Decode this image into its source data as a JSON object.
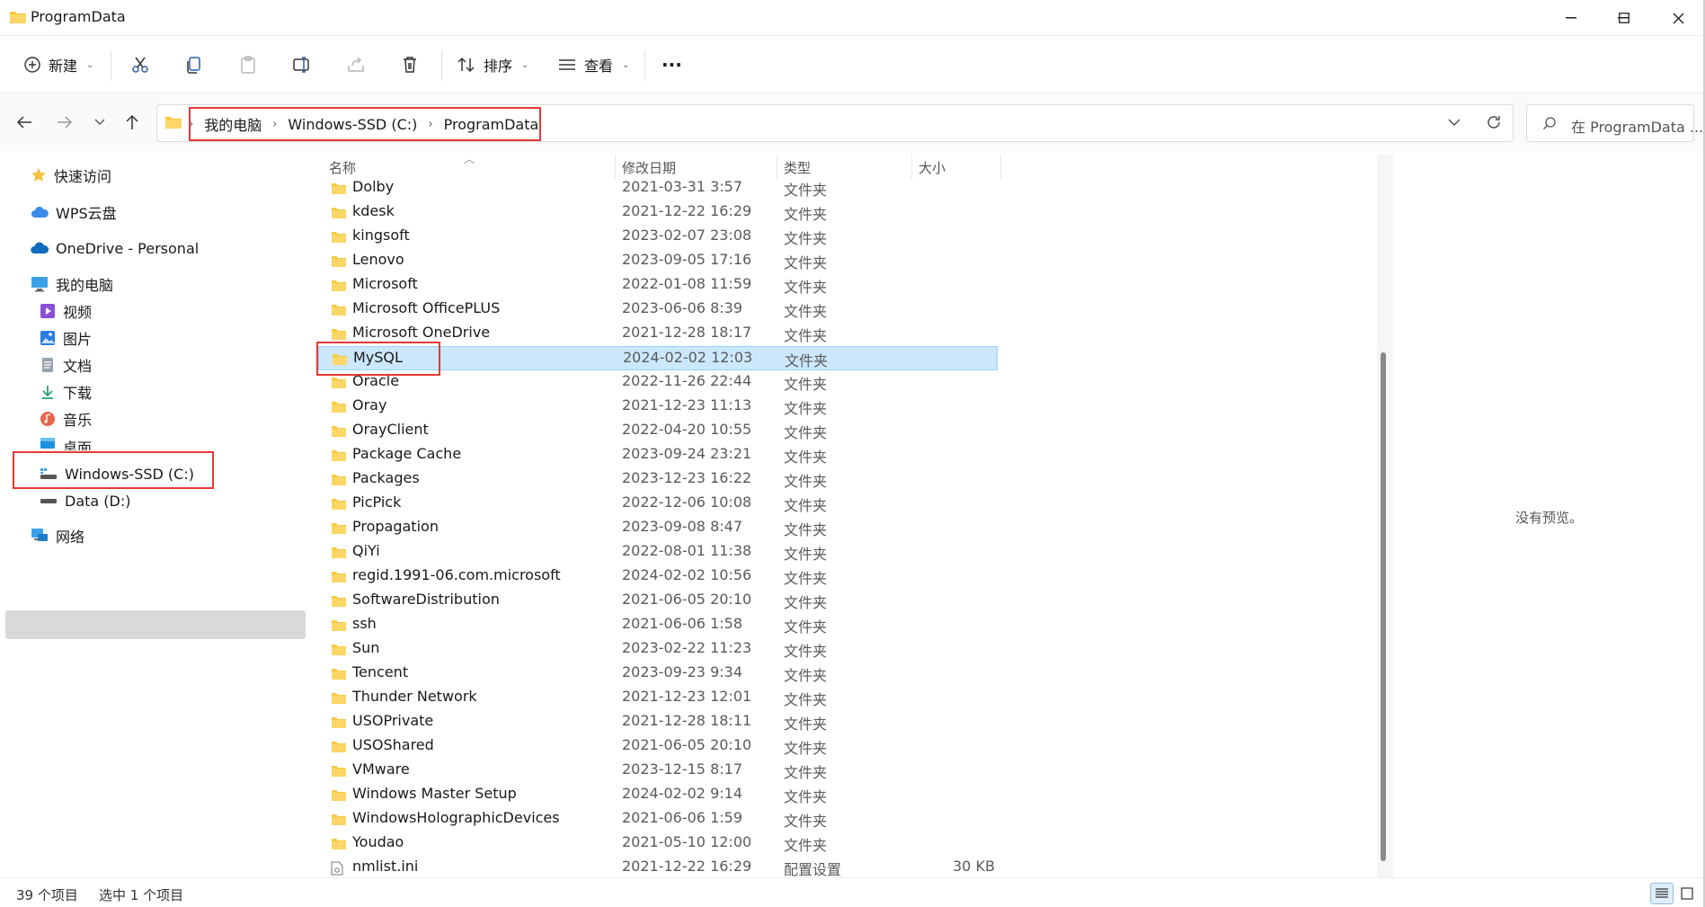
{
  "window": {
    "title": "ProgramData",
    "minimize_icon": "minimize-icon",
    "maximize_icon": "maximize-icon",
    "close_icon": "close-icon"
  },
  "toolbar": {
    "new_label": "新建",
    "sort_label": "排序",
    "view_label": "查看",
    "more_label": "···"
  },
  "address": {
    "crumbs": [
      "我的电脑",
      "Windows-SSD (C:)",
      "ProgramData"
    ],
    "search_placeholder": "在 ProgramData ..."
  },
  "sidebar": {
    "items": [
      {
        "label": "快速访问",
        "icon": "star-icon"
      },
      {
        "label": "WPS云盘",
        "icon": "cloud-icon"
      },
      {
        "label": "OneDrive - Personal",
        "icon": "onedrive-icon"
      },
      {
        "label": "我的电脑",
        "icon": "computer-icon"
      },
      {
        "label": "视频",
        "icon": "video-icon"
      },
      {
        "label": "图片",
        "icon": "picture-icon"
      },
      {
        "label": "文档",
        "icon": "document-icon"
      },
      {
        "label": "下载",
        "icon": "download-icon"
      },
      {
        "label": "音乐",
        "icon": "music-icon"
      },
      {
        "label": "桌面",
        "icon": "desktop-icon"
      },
      {
        "label": "Windows-SSD (C:)",
        "icon": "drive-icon"
      },
      {
        "label": "Data (D:)",
        "icon": "drive-icon"
      },
      {
        "label": "网络",
        "icon": "network-icon"
      }
    ]
  },
  "columns": {
    "name": "名称",
    "date": "修改日期",
    "type": "类型",
    "size": "大小"
  },
  "files": [
    {
      "name": "Dolby",
      "date": "2021-03-31 3:57",
      "type": "文件夹",
      "size": ""
    },
    {
      "name": "kdesk",
      "date": "2021-12-22 16:29",
      "type": "文件夹",
      "size": ""
    },
    {
      "name": "kingsoft",
      "date": "2023-02-07 23:08",
      "type": "文件夹",
      "size": ""
    },
    {
      "name": "Lenovo",
      "date": "2023-09-05 17:16",
      "type": "文件夹",
      "size": ""
    },
    {
      "name": "Microsoft",
      "date": "2022-01-08 11:59",
      "type": "文件夹",
      "size": ""
    },
    {
      "name": "Microsoft OfficePLUS",
      "date": "2023-06-06 8:39",
      "type": "文件夹",
      "size": ""
    },
    {
      "name": "Microsoft OneDrive",
      "date": "2021-12-28 18:17",
      "type": "文件夹",
      "size": ""
    },
    {
      "name": "MySQL",
      "date": "2024-02-02 12:03",
      "type": "文件夹",
      "size": ""
    },
    {
      "name": "Oracle",
      "date": "2022-11-26 22:44",
      "type": "文件夹",
      "size": ""
    },
    {
      "name": "Oray",
      "date": "2021-12-23 11:13",
      "type": "文件夹",
      "size": ""
    },
    {
      "name": "OrayClient",
      "date": "2022-04-20 10:55",
      "type": "文件夹",
      "size": ""
    },
    {
      "name": "Package Cache",
      "date": "2023-09-24 23:21",
      "type": "文件夹",
      "size": ""
    },
    {
      "name": "Packages",
      "date": "2023-12-23 16:22",
      "type": "文件夹",
      "size": ""
    },
    {
      "name": "PicPick",
      "date": "2022-12-06 10:08",
      "type": "文件夹",
      "size": ""
    },
    {
      "name": "Propagation",
      "date": "2023-09-08 8:47",
      "type": "文件夹",
      "size": ""
    },
    {
      "name": "QiYi",
      "date": "2022-08-01 11:38",
      "type": "文件夹",
      "size": ""
    },
    {
      "name": "regid.1991-06.com.microsoft",
      "date": "2024-02-02 10:56",
      "type": "文件夹",
      "size": ""
    },
    {
      "name": "SoftwareDistribution",
      "date": "2021-06-05 20:10",
      "type": "文件夹",
      "size": ""
    },
    {
      "name": "ssh",
      "date": "2021-06-06 1:58",
      "type": "文件夹",
      "size": ""
    },
    {
      "name": "Sun",
      "date": "2023-02-22 11:23",
      "type": "文件夹",
      "size": ""
    },
    {
      "name": "Tencent",
      "date": "2023-09-23 9:34",
      "type": "文件夹",
      "size": ""
    },
    {
      "name": "Thunder Network",
      "date": "2021-12-23 12:01",
      "type": "文件夹",
      "size": ""
    },
    {
      "name": "USOPrivate",
      "date": "2021-12-28 18:11",
      "type": "文件夹",
      "size": ""
    },
    {
      "name": "USOShared",
      "date": "2021-06-05 20:10",
      "type": "文件夹",
      "size": ""
    },
    {
      "name": "VMware",
      "date": "2023-12-15 8:17",
      "type": "文件夹",
      "size": ""
    },
    {
      "name": "Windows Master Setup",
      "date": "2024-02-02 9:14",
      "type": "文件夹",
      "size": ""
    },
    {
      "name": "WindowsHolographicDevices",
      "date": "2021-06-06 1:59",
      "type": "文件夹",
      "size": ""
    },
    {
      "name": "Youdao",
      "date": "2021-05-10 12:00",
      "type": "文件夹",
      "size": ""
    },
    {
      "name": "nmlist.ini",
      "date": "2021-12-22 16:29",
      "type": "配置设置",
      "size": "30 KB"
    }
  ],
  "selected_file": "MySQL",
  "preview": {
    "empty_text": "没有预览。"
  },
  "status": {
    "item_count": "39 个项目",
    "selection": "选中 1 个项目"
  },
  "colors": {
    "selection_bg": "#cce8ff",
    "highlight_box": "#e53935",
    "folder_yellow": "#f8c940"
  }
}
